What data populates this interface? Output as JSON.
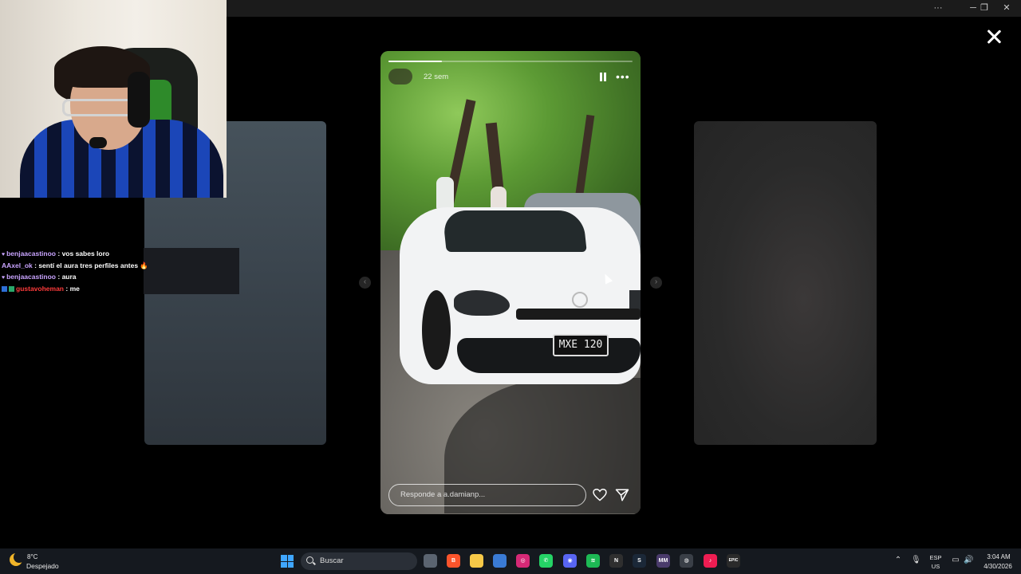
{
  "window": {
    "controls": {
      "more": "···",
      "minimize": "─",
      "restore": "❐",
      "close": "✕"
    }
  },
  "stream_overlay": {
    "chat": [
      {
        "user": "benjaacastinoo",
        "message": ": vos sabes loro",
        "user_color": "#c9a4ff"
      },
      {
        "user": "AAxel_ok",
        "message": ": sentí el aura tres perfiles antes 🔥",
        "user_color": "#c9a4ff"
      },
      {
        "user": "benjaacastinoo",
        "message": ": aura",
        "user_color": "#c9a4ff"
      },
      {
        "user": "gustavoheman",
        "message": ": me",
        "user_color": "#ff3b3b"
      }
    ]
  },
  "story": {
    "time_ago": "22 sem",
    "progress": 0.22,
    "reply_placeholder": "Responde a a.damianp...",
    "plate_text": "MXE 120",
    "icons": {
      "pause": "pause-icon",
      "more": "more-options-icon",
      "like": "heart-icon",
      "send": "send-icon",
      "close": "close-icon"
    }
  },
  "nav": {
    "prev": "‹",
    "next": "›"
  },
  "taskbar": {
    "weather_temp": "8°C",
    "weather_desc": "Despejado",
    "search_label": "Buscar",
    "language": "ESP",
    "region": "US",
    "time": "3:04 AM",
    "date": "4/30/2026",
    "apps": [
      {
        "name": "task-view",
        "glyph": "",
        "color": "#5b6470"
      },
      {
        "name": "brave",
        "glyph": "B",
        "color": "#fb542b"
      },
      {
        "name": "file-explorer",
        "glyph": "",
        "color": "#f7c948"
      },
      {
        "name": "microsoft-store",
        "glyph": "",
        "color": "#3a7bd5"
      },
      {
        "name": "instagram",
        "glyph": "◎",
        "color": "#d62976"
      },
      {
        "name": "whatsapp",
        "glyph": "✆",
        "color": "#25d366"
      },
      {
        "name": "discord",
        "glyph": "◉",
        "color": "#5865f2"
      },
      {
        "name": "spotify",
        "glyph": "≋",
        "color": "#1db954"
      },
      {
        "name": "notion",
        "glyph": "N",
        "color": "#2f2f2f"
      },
      {
        "name": "steam",
        "glyph": "S",
        "color": "#1b2838"
      },
      {
        "name": "mm-app",
        "glyph": "MM",
        "color": "#4a3b6b"
      },
      {
        "name": "chrome",
        "glyph": "◍",
        "color": "#3a3f47"
      },
      {
        "name": "tiktok",
        "glyph": "♪",
        "color": "#ee1d52"
      },
      {
        "name": "epic-games",
        "glyph": "EPIC",
        "color": "#2a2a2a"
      }
    ]
  }
}
